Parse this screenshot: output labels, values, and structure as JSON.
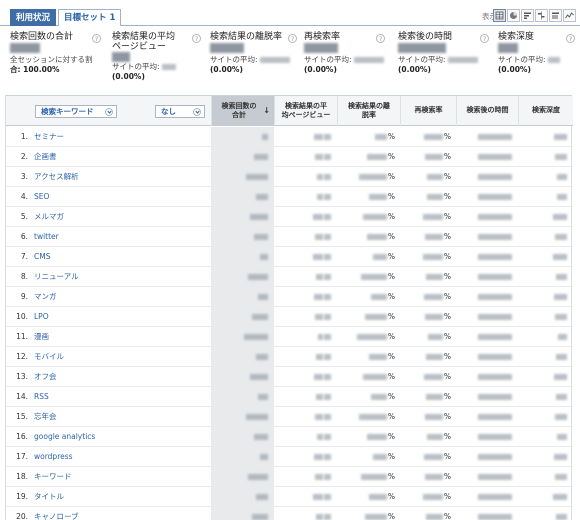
{
  "tabs": {
    "active": "利用状況",
    "inactive": "目標セット 1"
  },
  "display_label": "表示:",
  "view_buttons": [
    "table-view-icon",
    "pie-view-icon",
    "performance-view-icon",
    "comparison-view-icon",
    "pivot-view-icon",
    "sparkline-view-icon"
  ],
  "scorecards": [
    {
      "title": "検索回数の合計",
      "sub": "全セッションに対する割",
      "sub2": "合: 100.00%"
    },
    {
      "title": "検索結果の平均",
      "title2": "ページビュー",
      "sub": "サイトの平均:",
      "pct": "(0.00%)"
    },
    {
      "title": "検索結果の離脱率",
      "sub": "サイトの平均:",
      "pct": "(0.00%)"
    },
    {
      "title": "再検索率",
      "sub": "サイトの平均:",
      "pct": "(0.00%)"
    },
    {
      "title": "検索後の時間",
      "sub": "サイトの平均:",
      "pct": "(0.00%)"
    },
    {
      "title": "検索深度",
      "sub": "サイトの平均:",
      "pct": "(0.00%)"
    }
  ],
  "help_glyph": "?",
  "table": {
    "keyword_select": "検索キーワード",
    "secondary_select": "なし",
    "columns": [
      {
        "l1": "検索回数の",
        "l2": "合計",
        "arrow": "↓"
      },
      {
        "l1": "検索結果の平",
        "l2": "均ページビュー"
      },
      {
        "l1": "検索結果の離",
        "l2": "脱率"
      },
      {
        "l1": "再検索率",
        "l2": ""
      },
      {
        "l1": "検索後の時間",
        "l2": ""
      },
      {
        "l1": "検索深度",
        "l2": ""
      }
    ],
    "percent_sign": "%",
    "rows": [
      {
        "n": "1.",
        "kw": "セミナー"
      },
      {
        "n": "2.",
        "kw": "企画書"
      },
      {
        "n": "3.",
        "kw": "アクセス解析"
      },
      {
        "n": "4.",
        "kw": "SEO"
      },
      {
        "n": "5.",
        "kw": "メルマガ"
      },
      {
        "n": "6.",
        "kw": "twitter"
      },
      {
        "n": "7.",
        "kw": "CMS"
      },
      {
        "n": "8.",
        "kw": "リニューアル"
      },
      {
        "n": "9.",
        "kw": "マンガ"
      },
      {
        "n": "10.",
        "kw": "LPO"
      },
      {
        "n": "11.",
        "kw": "漫画"
      },
      {
        "n": "12.",
        "kw": "モバイル"
      },
      {
        "n": "13.",
        "kw": "オフ会"
      },
      {
        "n": "14.",
        "kw": "RSS"
      },
      {
        "n": "15.",
        "kw": "忘年会"
      },
      {
        "n": "16.",
        "kw": "google analytics"
      },
      {
        "n": "17.",
        "kw": "wordpress"
      },
      {
        "n": "18.",
        "kw": "キーワード"
      },
      {
        "n": "19.",
        "kw": "タイトル"
      },
      {
        "n": "20.",
        "kw": "キャノローブ"
      }
    ]
  },
  "colors": {
    "tab_active": "#3f6ea6",
    "link": "#2a62a8",
    "sorted_header": "#c6cbd1",
    "sorted_cell": "#e8eaec"
  }
}
